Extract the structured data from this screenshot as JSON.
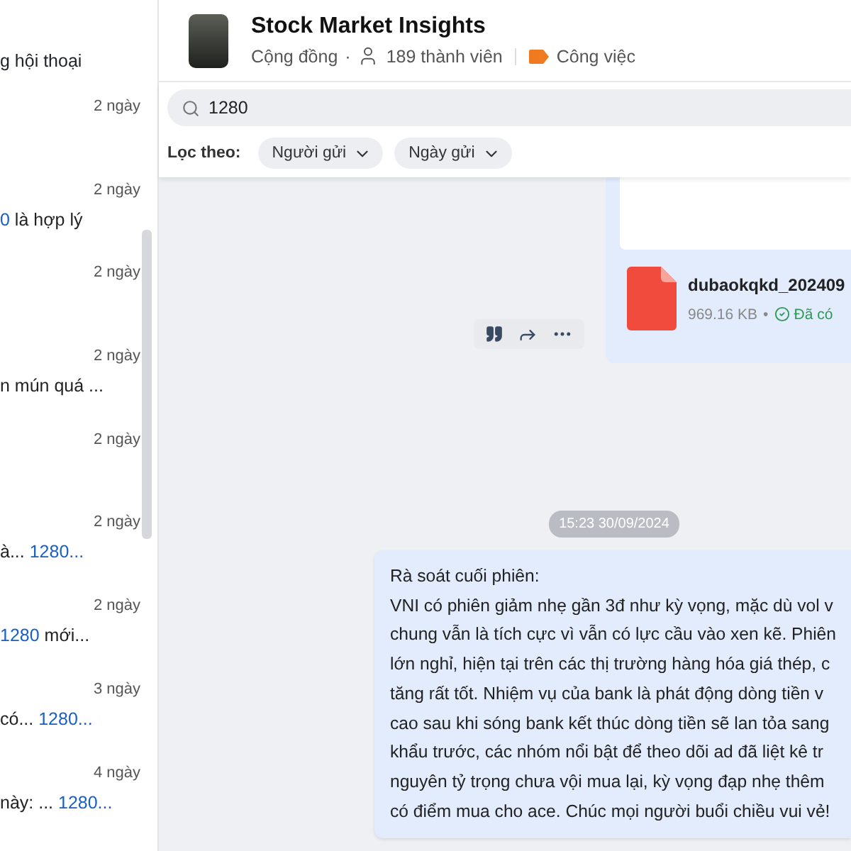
{
  "sidebar": {
    "top_snippet": "g hội thoại",
    "results": [
      {
        "time": "2 ngày"
      },
      {
        "time": "2 ngày",
        "snippet": [
          {
            "text": "0",
            "highlight": true
          },
          {
            "text": " là hợp lý",
            "highlight": false
          }
        ]
      },
      {
        "time": "2 ngày"
      },
      {
        "time": "2 ngày",
        "snippet": [
          {
            "text": "n mún quá ...",
            "highlight": false
          }
        ]
      },
      {
        "time": "2 ngày"
      },
      {
        "time": "2 ngày",
        "snippet": [
          {
            "text": "à... ",
            "highlight": false
          },
          {
            "text": "1280...",
            "highlight": true
          }
        ]
      },
      {
        "time": "2 ngày",
        "snippet": [
          {
            "text": "1280",
            "highlight": true
          },
          {
            "text": " mới...",
            "highlight": false
          }
        ]
      },
      {
        "time": "3 ngày",
        "snippet": [
          {
            "text": "có... ",
            "highlight": false
          },
          {
            "text": "1280...",
            "highlight": true
          }
        ]
      },
      {
        "time": "4 ngày",
        "snippet": [
          {
            "text": "này: ... ",
            "highlight": false
          },
          {
            "text": "1280...",
            "highlight": true
          }
        ]
      }
    ]
  },
  "conversation": {
    "title": "Stock Market Insights",
    "type": "Cộng đồng",
    "separator": "·",
    "members": "189 thành viên",
    "tag": "Công việc"
  },
  "search": {
    "value": "1280"
  },
  "filter": {
    "label": "Lọc theo:",
    "chips": [
      "Người gửi",
      "Ngày gửi"
    ]
  },
  "messages": [
    {
      "kind": "file",
      "file_name": "dubaokqkd_202409",
      "size": "969.16 KB",
      "separator": "•",
      "status": "Đã có"
    },
    {
      "kind": "timestamp",
      "text": "15:23 30/09/2024"
    },
    {
      "kind": "text",
      "lines": [
        "Rà soát cuối phiên:",
        "VNI có phiên giảm nhẹ gần 3đ như kỳ vọng, mặc dù vol v",
        "chung vẫn là tích cực vì vẫn có lực cầu vào xen kẽ. Phiên",
        "lớn nghỉ, hiện tại trên các thị trường hàng hóa giá thép, c",
        "tăng rất tốt. Nhiệm vụ của bank là phát động dòng tiền v",
        "cao sau khi sóng bank kết thúc dòng tiền sẽ lan tỏa sang",
        "khẩu trước, các nhóm nổi bật để theo dõi ad đã liệt kê tr",
        "nguyên tỷ trọng chưa vội mua lại, kỳ vọng đạp nhẹ thêm",
        "có điểm mua cho ace. Chúc mọi người buổi chiều vui vẻ!"
      ]
    }
  ]
}
